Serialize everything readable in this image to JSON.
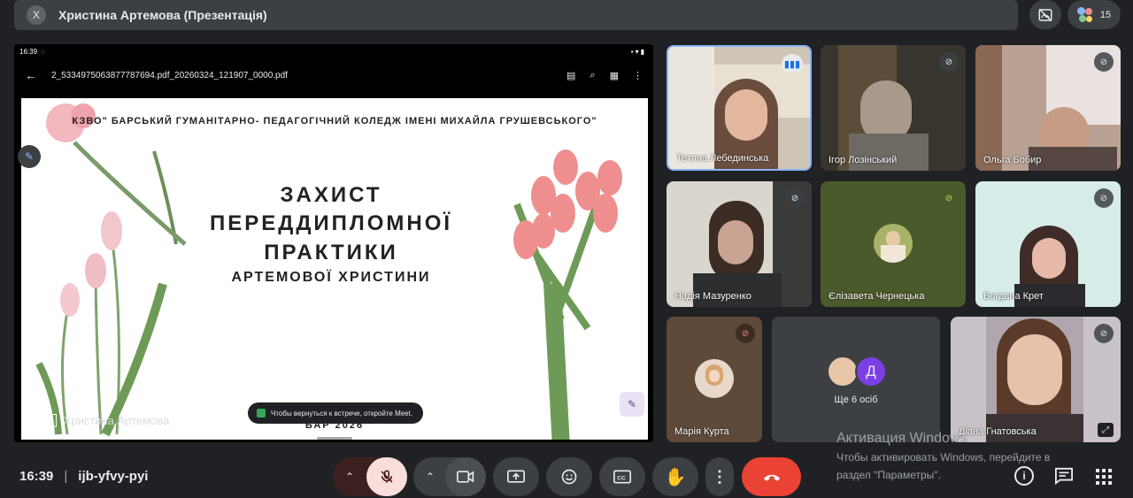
{
  "header": {
    "close_label": "X",
    "title": "Христина Артемова (Презентація)",
    "participant_count": "15"
  },
  "presentation": {
    "status_time": "16:39",
    "file_name": "2_5334975063877787694.pdf_20260324_121907_0000.pdf",
    "slide": {
      "college": "КЗВО\" БАРСЬКИЙ ГУМАНІТАРНО- ПЕДАГОГІЧНИЙ КОЛЕДЖ ІМЕНІ МИХАЙЛА ГРУШЕВСЬКОГО\"",
      "line1": "ЗАХИСТ",
      "line2": "ПЕРЕДДИПЛОМНОЇ",
      "line3": "ПРАКТИКИ",
      "line4": "АРТЕМОВОЇ ХРИСТИНИ",
      "footer": "БАР 2026"
    },
    "presenter_name": "Христина Артемова",
    "toast": "Чтобы вернуться к встрече, откройте Meet."
  },
  "participants": [
    {
      "name": "Тетяна Лебединська"
    },
    {
      "name": "Ігор Лозінський"
    },
    {
      "name": "Ольга Бобир"
    },
    {
      "name": "Надія Мазуренко"
    },
    {
      "name": "Єлізавета Чернецька"
    },
    {
      "name": "Богдана Крет"
    },
    {
      "name": "Марія Курта"
    },
    {
      "name": "Діана Гнатовська"
    }
  ],
  "others": {
    "label": "Ще 6 осіб",
    "avatar_letter": "Д"
  },
  "bottom": {
    "time": "16:39",
    "separator": "|",
    "meeting_code": "ijb-yfvy-pyi"
  },
  "watermark": {
    "title": "Активация Windows",
    "line1": "Чтобы активировать Windows, перейдите в",
    "line2": "раздел \"Параметры\"."
  },
  "colors": {
    "bg": "#202124",
    "panel": "#3c4043",
    "end_call": "#ea4335",
    "mic_off": "#f9dedc",
    "speaking_border": "#8ab4f8"
  }
}
